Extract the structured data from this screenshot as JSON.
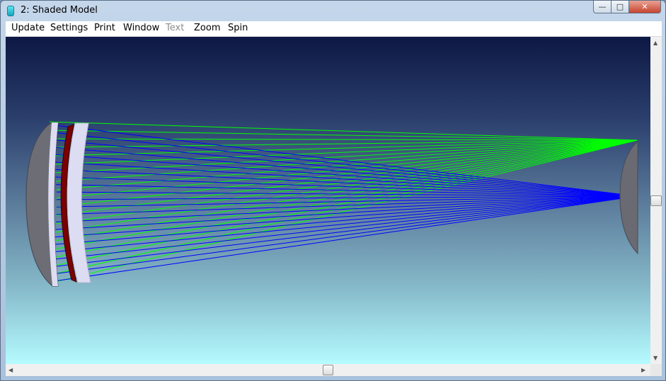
{
  "window": {
    "title": "2: Shaded Model",
    "controls": {
      "minimize": "—",
      "maximize": "□",
      "close": "✕"
    }
  },
  "menu": [
    {
      "label": "Update",
      "enabled": true
    },
    {
      "label": "Settings",
      "enabled": true
    },
    {
      "label": "Print",
      "enabled": true
    },
    {
      "label": "Window",
      "enabled": true
    },
    {
      "label": "Text",
      "enabled": false
    },
    {
      "label": "Zoom",
      "enabled": true
    },
    {
      "label": "Spin",
      "enabled": true
    }
  ],
  "scrollbar_icons": {
    "up": "up-arrow-icon",
    "down": "down-arrow-icon",
    "left": "left-arrow-icon",
    "right": "right-arrow-icon"
  },
  "colors": {
    "ray_green": "#00ff00",
    "ray_blue": "#0000ff",
    "lens_face": "#d9d9f2",
    "lens_edge": "#6a6a72",
    "coating": "#7a0000"
  }
}
